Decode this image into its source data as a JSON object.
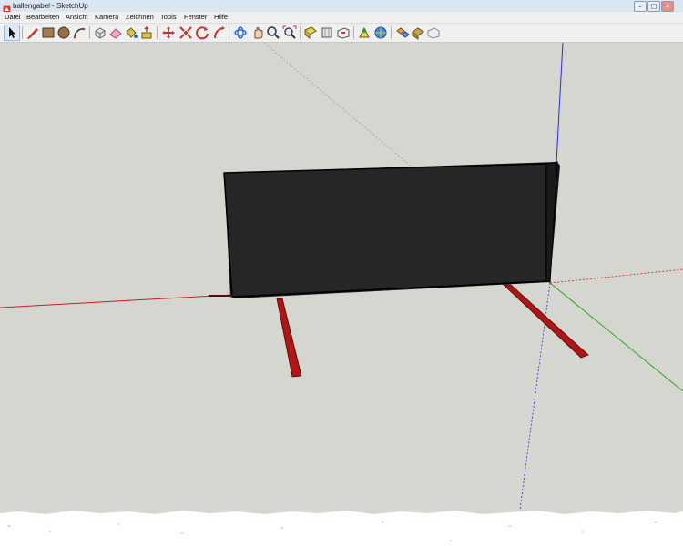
{
  "window": {
    "title": "ballengabel - SketchUp",
    "app_icon": "sketchup-logo-icon",
    "controls": [
      "minimize-icon",
      "maximize-icon",
      "close-icon"
    ]
  },
  "menu": {
    "items": [
      "Datei",
      "Bearbeiten",
      "Ansicht",
      "Kamera",
      "Zeichnen",
      "Tools",
      "Fenster",
      "Hilfe"
    ]
  },
  "toolbar": {
    "tools": [
      "select-arrow-icon",
      "pencil-line-icon",
      "rectangle-icon",
      "circle-icon",
      "arc-icon",
      "make-component-icon",
      "eraser-icon",
      "paint-bucket-icon",
      "push-pull-icon",
      "move-icon",
      "rotate-icon",
      "offset-icon",
      "orbit-icon",
      "pan-hand-icon",
      "zoom-icon",
      "zoom-extents-icon",
      "follow-me-icon",
      "scale-icon",
      "section-plane-icon",
      "walk-icon",
      "position-camera-icon",
      "look-around-icon",
      "get-models-icon",
      "share-model-icon",
      "send-to-layout-icon"
    ]
  },
  "colors": {
    "viewport_background": "#d6d6d0",
    "panel_face": "#262626",
    "leg_red": "#b21515",
    "axis_red": "#c81e1e",
    "axis_green": "#2aa62a",
    "axis_blue": "#2a2ae0"
  }
}
